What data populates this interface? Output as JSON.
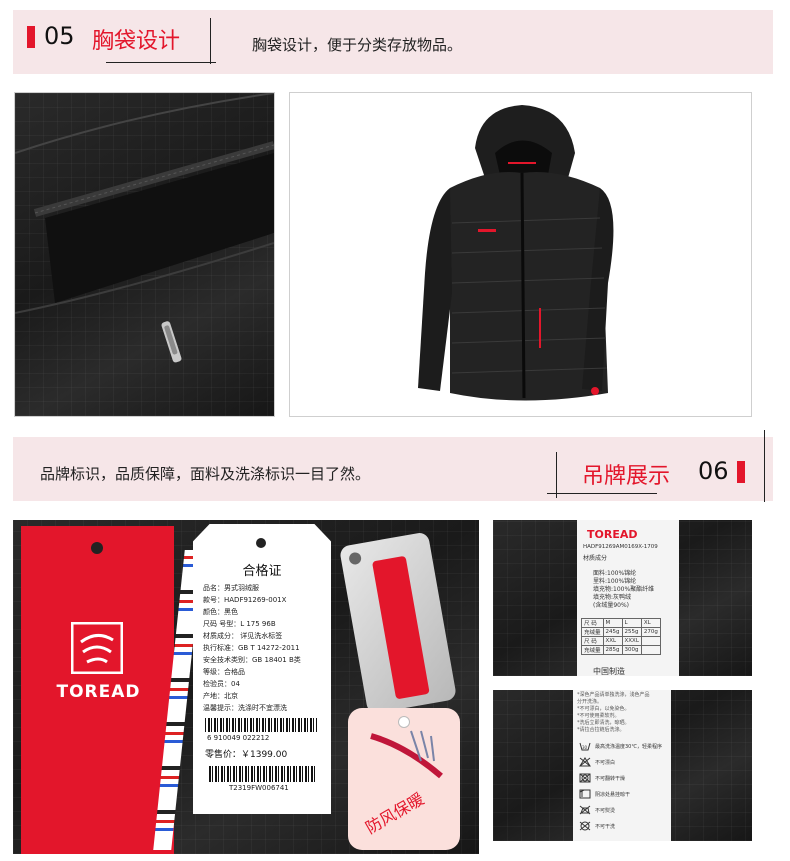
{
  "section1": {
    "number": "05",
    "title": "胸袋设计",
    "description": "胸袋设计，便于分类存放物品。"
  },
  "section2": {
    "number": "06",
    "title": "吊牌展示",
    "description": "品牌标识，品质保障，面料及洗涤标识一目了然。"
  },
  "brand": {
    "name": "TOREAD",
    "color": "#e3162b"
  },
  "cert_tag": {
    "title": "合格证",
    "lines": [
      "品名：男式羽绒服",
      "款号：HADF91269-001X",
      "颜色：黑色",
      "尺码 号型：L 175 96B",
      "材质成分：    详见洗水标签",
      "执行标准：GB T 14272-2011",
      "安全技术类别：GB 18401 B类",
      "等级：合格品",
      "检验员：04",
      "产地：北京",
      "温馨提示：洗涤时不宜漂洗"
    ],
    "barcode_number": "6 910049 022212",
    "price": "零售价：￥1399.00",
    "code": "T2319FW006741"
  },
  "feature_tag": {
    "text": "防风保暖"
  },
  "material_label": {
    "brand": "TOREAD",
    "code": "HADF91269AM0169X-1709",
    "heading": "材质成分",
    "lines": [
      "面料:100%锦纶",
      "里料:100%锦纶",
      "填充物:100%聚酯纤维",
      "填充物:灰鸭绒",
      "(含绒量90%)"
    ],
    "size_table": {
      "rows": [
        [
          "尺 码",
          "M",
          "L",
          "XL"
        ],
        [
          "充绒量",
          "245g",
          "255g",
          "270g"
        ],
        [
          "尺 码",
          "XXL",
          "XXXL",
          ""
        ],
        [
          "充绒量",
          "285g",
          "300g",
          ""
        ]
      ]
    },
    "origin": "中国制造"
  },
  "care_label": {
    "lines": [
      "*深色产品请单独洗涤，浅色产品",
      "分开洗涤。",
      "*不可漂白，以免染色。",
      "*不可使用柔软剂。",
      "*洗后立即清洗，晾晒。",
      "*请拉合拉链后洗涤。"
    ],
    "symbols": [
      {
        "icon": "wash-30-icon",
        "text": "最高洗涤温度30℃，轻柔程序"
      },
      {
        "icon": "no-bleach-icon",
        "text": "不可漂白"
      },
      {
        "icon": "no-tumble-dry-icon",
        "text": "不可翻转干燥"
      },
      {
        "icon": "line-dry-shade-icon",
        "text": "阴凉处悬挂晾干"
      },
      {
        "icon": "no-iron-icon",
        "text": "不可熨烫"
      },
      {
        "icon": "no-dry-clean-icon",
        "text": "不可干洗"
      }
    ]
  }
}
